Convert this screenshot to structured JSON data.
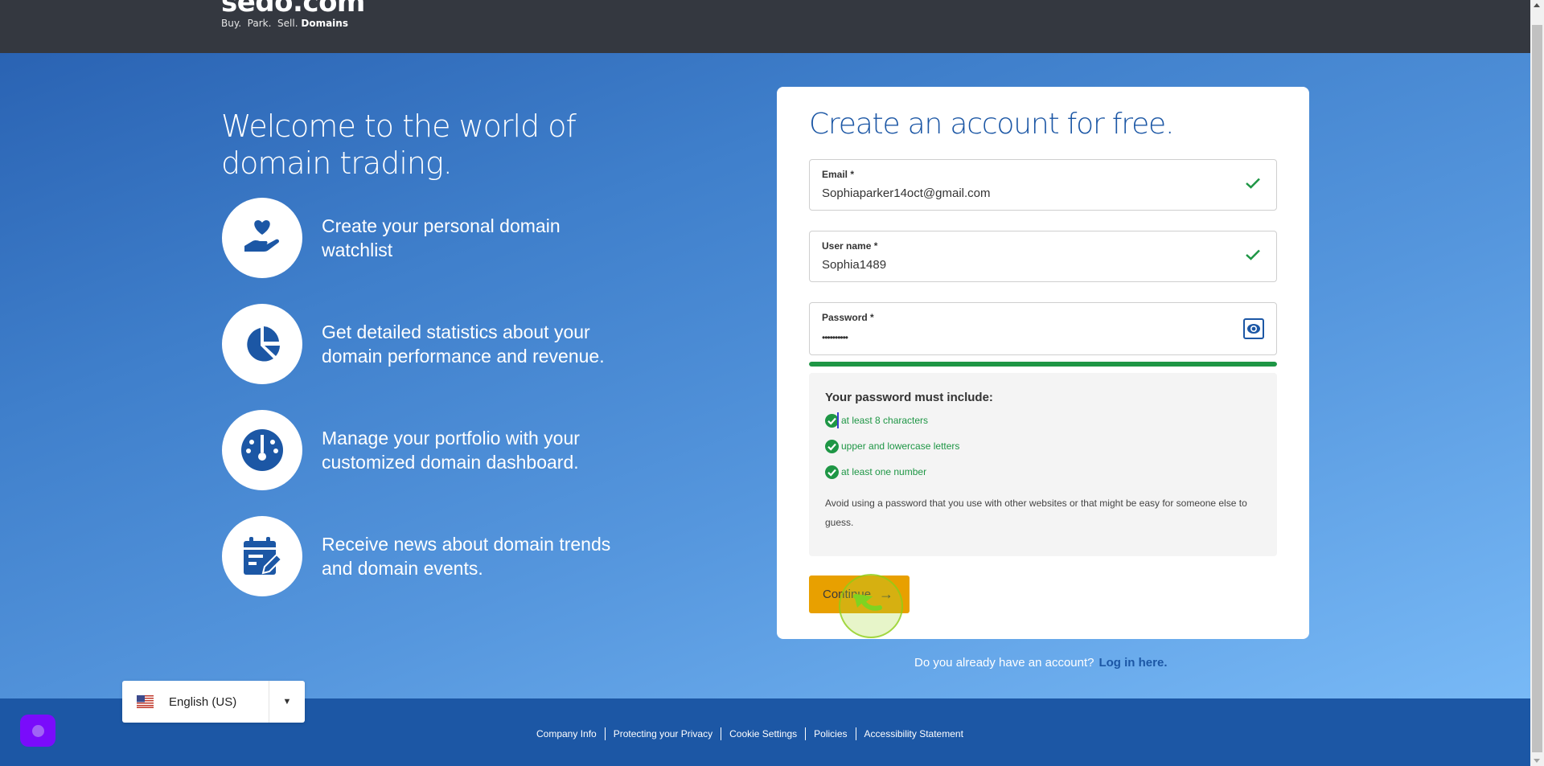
{
  "header": {
    "logo_main": "sedo.com",
    "logo_tagline": "Buy.  Park.  Sell.",
    "logo_tagline_bold": "Domains"
  },
  "intro": {
    "heading": "Welcome to the world of domain trading.",
    "features": [
      {
        "icon": "hand-heart-icon",
        "text": "Create your personal domain watchlist"
      },
      {
        "icon": "pie-chart-icon",
        "text": "Get detailed statistics about your domain performance and revenue."
      },
      {
        "icon": "dashboard-gauge-icon",
        "text": "Manage your portfolio with your customized domain dashboard."
      },
      {
        "icon": "calendar-edit-icon",
        "text": "Receive news about domain trends and domain events."
      }
    ]
  },
  "form": {
    "title": "Create an account for free.",
    "email": {
      "label": "Email *",
      "value": "Sophiaparker14oct@gmail.com",
      "valid": true
    },
    "username": {
      "label": "User name *",
      "value": "Sophia1489",
      "valid": true
    },
    "password": {
      "label": "Password *",
      "value": "••••••••••",
      "toggle_icon": "eye-icon"
    },
    "strength": {
      "percent": 100,
      "color": "#1e9645"
    },
    "requirements": {
      "title": "Your password must include:",
      "items": [
        {
          "text": "at least 8 characters",
          "met": true
        },
        {
          "text": "upper and lowercase letters",
          "met": true
        },
        {
          "text": "at least one number",
          "met": true
        }
      ],
      "note": "Avoid using a password that you use with other websites or that might be easy for someone else to guess."
    },
    "continue_label": "Continue",
    "continue_icon": "arrow-right-icon"
  },
  "login": {
    "prompt": "Do you already have an account?",
    "link": "Log in here."
  },
  "language": {
    "selected": "English (US)",
    "flag": "us-flag-icon"
  },
  "footer": {
    "links": [
      "Company Info",
      "Protecting your Privacy",
      "Cookie Settings",
      "Policies",
      "Accessibility Statement"
    ]
  },
  "colors": {
    "brand_blue": "#1c57a5",
    "header_bg": "#343840",
    "success_green": "#1e9645",
    "button_orange": "#e8a000",
    "widget_purple": "#7a0cfb"
  }
}
